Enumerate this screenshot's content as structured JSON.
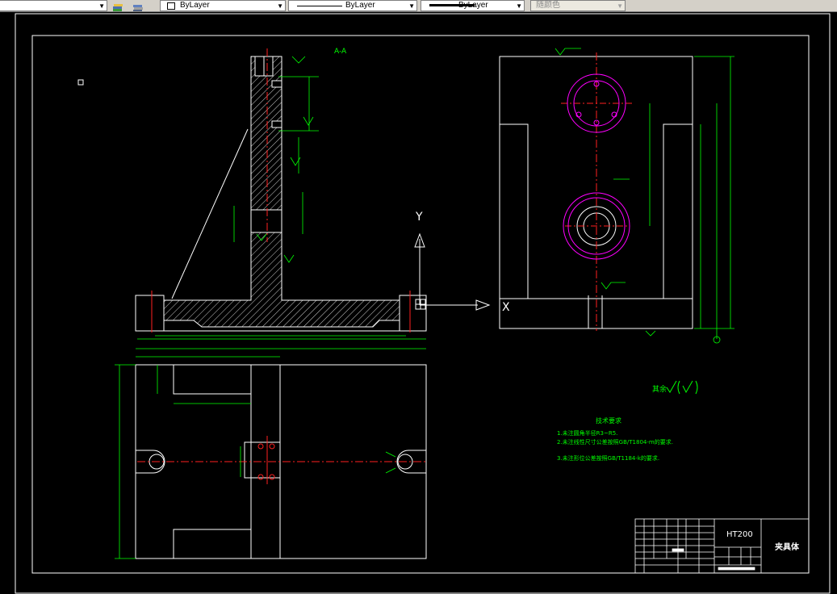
{
  "toolbar": {
    "layer_combo_value": "ByLayer",
    "linetype_combo_value": "ByLayer",
    "lineweight_combo_value": "ByLayer",
    "plotstyle_combo_value": "随颜色"
  },
  "drawing": {
    "section_label": "A-A",
    "axis_y_label": "Y",
    "axis_x_label": "X",
    "surface_note": "其余",
    "tech_req_title": "技术要求",
    "tech_req_lines": [
      "1.未注圆角半径R3~R5.",
      "2.未注线性尺寸公差按照GB/T1804-m的要求.",
      "3.未注形位公差按照GB/T1184-k的要求."
    ],
    "title_block": {
      "material": "HT200",
      "part_name": "夹具体"
    }
  },
  "colors": {
    "background": "#000000",
    "geometry": "#ffffff",
    "dimension": "#00ff00",
    "centerline": "#ff2020",
    "hidden": "#ff00ff",
    "toolbar": "#d4d0c8"
  }
}
